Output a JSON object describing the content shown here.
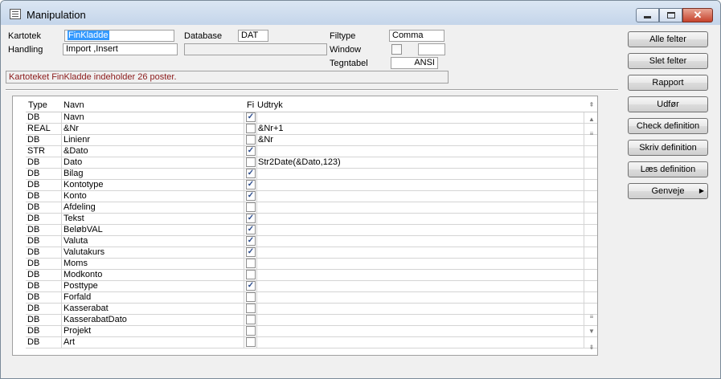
{
  "window": {
    "title": "Manipulation"
  },
  "form": {
    "kartotek_label": "Kartotek",
    "kartotek_value": "FinKladde",
    "handling_label": "Handling",
    "handling_value": "Import ,Insert",
    "database_label": "Database",
    "database_value": "DAT",
    "filtype_label": "Filtype",
    "filtype_value": "Comma",
    "window_label": "Window",
    "tegntabel_label": "Tegntabel",
    "tegntabel_value": "ANSI"
  },
  "status": "Kartoteket FinKladde indeholder 26 poster.",
  "buttons": {
    "alle_felter": "Alle felter",
    "slet_felter": "Slet felter",
    "rapport": "Rapport",
    "udfor": "Udfør",
    "check_definition": "Check definition",
    "skriv_definition": "Skriv definition",
    "laes_definition": "Læs   definition",
    "genveje": "Genveje"
  },
  "grid": {
    "columns": {
      "type": "Type",
      "navn": "Navn",
      "fi": "Fi",
      "udtryk": "Udtryk"
    },
    "rows": [
      {
        "type": "DB",
        "navn": "Navn",
        "checked": true,
        "udtryk": ""
      },
      {
        "type": "REAL",
        "navn": "&Nr",
        "checked": false,
        "udtryk": "&Nr+1"
      },
      {
        "type": "DB",
        "navn": "Linienr",
        "checked": false,
        "udtryk": "&Nr"
      },
      {
        "type": "STR",
        "navn": "&Dato",
        "checked": true,
        "udtryk": ""
      },
      {
        "type": "DB",
        "navn": "Dato",
        "checked": false,
        "udtryk": "Str2Date(&Dato,123)"
      },
      {
        "type": "DB",
        "navn": "Bilag",
        "checked": true,
        "udtryk": ""
      },
      {
        "type": "DB",
        "navn": "Kontotype",
        "checked": true,
        "udtryk": ""
      },
      {
        "type": "DB",
        "navn": "Konto",
        "checked": true,
        "udtryk": ""
      },
      {
        "type": "DB",
        "navn": "Afdeling",
        "checked": false,
        "udtryk": ""
      },
      {
        "type": "DB",
        "navn": "Tekst",
        "checked": true,
        "udtryk": ""
      },
      {
        "type": "DB",
        "navn": "BeløbVAL",
        "checked": true,
        "udtryk": ""
      },
      {
        "type": "DB",
        "navn": "Valuta",
        "checked": true,
        "udtryk": ""
      },
      {
        "type": "DB",
        "navn": "Valutakurs",
        "checked": true,
        "udtryk": ""
      },
      {
        "type": "DB",
        "navn": "Moms",
        "checked": false,
        "udtryk": ""
      },
      {
        "type": "DB",
        "navn": "Modkonto",
        "checked": false,
        "udtryk": ""
      },
      {
        "type": "DB",
        "navn": "Posttype",
        "checked": true,
        "udtryk": ""
      },
      {
        "type": "DB",
        "navn": "Forfald",
        "checked": false,
        "udtryk": ""
      },
      {
        "type": "DB",
        "navn": "Kasserabat",
        "checked": false,
        "udtryk": ""
      },
      {
        "type": "DB",
        "navn": "KasserabatDato",
        "checked": false,
        "udtryk": ""
      },
      {
        "type": "DB",
        "navn": "Projekt",
        "checked": false,
        "udtryk": ""
      },
      {
        "type": "DB",
        "navn": "Art",
        "checked": false,
        "udtryk": ""
      }
    ]
  }
}
